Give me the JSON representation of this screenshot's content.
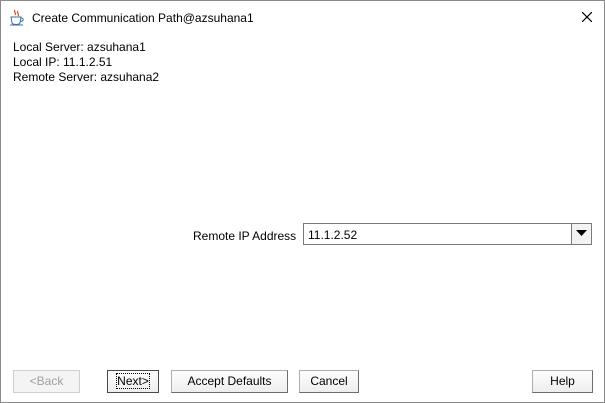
{
  "window": {
    "title": "Create Communication Path@azsuhana1",
    "icon": "java-coffee-cup-icon",
    "close_icon": "close-icon"
  },
  "info": {
    "local_server": "Local Server: azsuhana1",
    "local_ip": "Local IP: 11.1.2.51",
    "remote_server": "Remote Server: azsuhana2"
  },
  "form": {
    "remote_ip_label": "Remote IP Address",
    "remote_ip_value": "11.1.2.52",
    "dropdown_icon": "triangle-down-icon"
  },
  "buttons": {
    "back": "<Back",
    "next": "Next>",
    "accept_defaults": "Accept Defaults",
    "cancel": "Cancel",
    "help": "Help"
  }
}
